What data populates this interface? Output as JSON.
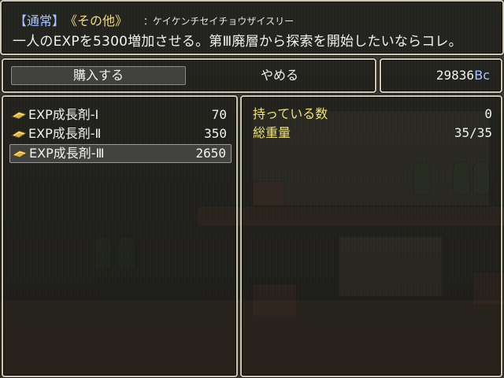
{
  "help": {
    "category": "【通常】",
    "item_name": "《その他》",
    "reading": "：ケイケンチセイチョウザイスリー",
    "description": "一人のEXPを5300増加させる。第Ⅲ廃層から探索を開始したいならコレ。"
  },
  "command": {
    "buy_label": "購入する",
    "quit_label": "やめる"
  },
  "gold": {
    "amount": "29836",
    "unit": "Bc"
  },
  "items": [
    {
      "name": "EXP成長剤-Ⅰ",
      "price": "70",
      "icon": "scroll-icon"
    },
    {
      "name": "EXP成長剤-Ⅱ",
      "price": "350",
      "icon": "scroll-icon"
    },
    {
      "name": "EXP成長剤-Ⅲ",
      "price": "2650",
      "icon": "scroll-icon"
    }
  ],
  "selected_item_index": 2,
  "status": {
    "owned_label": "持っている数",
    "owned_value": "0",
    "weight_label": "総重量",
    "weight_value": "35/35"
  },
  "colors": {
    "category": "#a8c6ff",
    "item_name": "#f0d98a",
    "status_label": "#f0e27a",
    "window_border": "#cfc7b3"
  }
}
